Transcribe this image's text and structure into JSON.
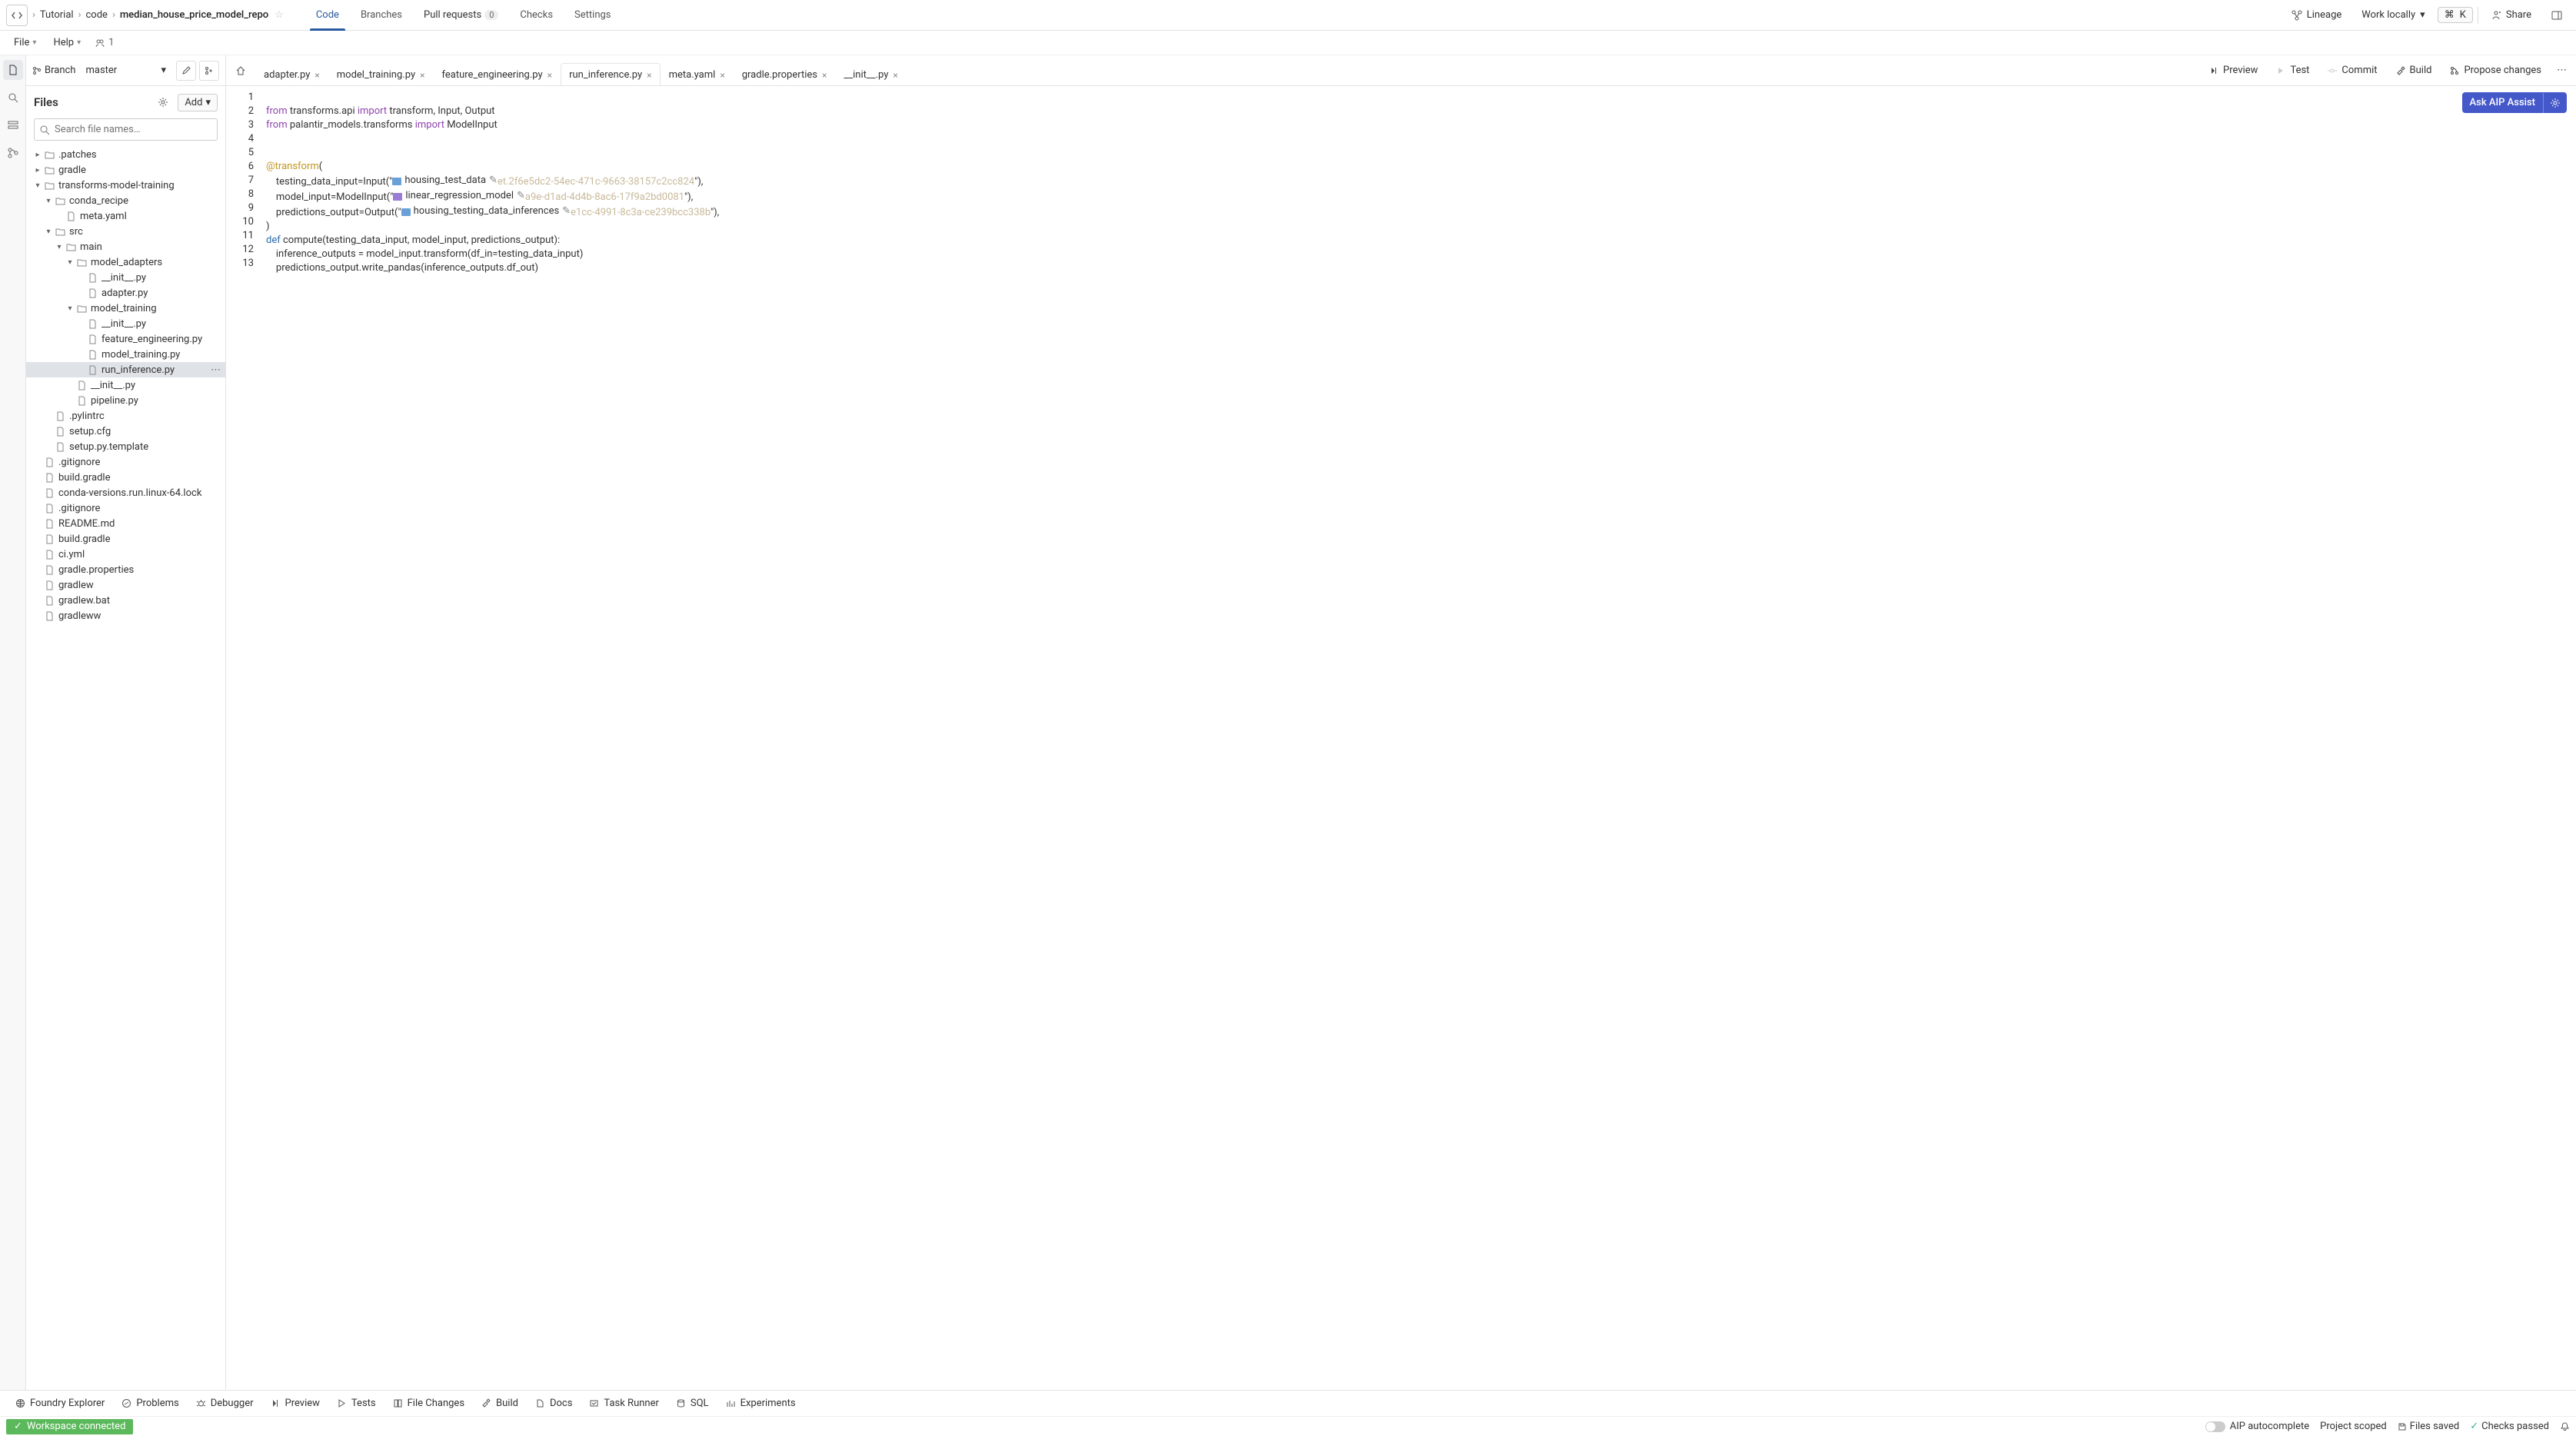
{
  "breadcrumb": [
    "Tutorial",
    "code",
    "median_house_price_model_repo"
  ],
  "menu": {
    "file": "File",
    "help": "Help",
    "avatar_count": "1"
  },
  "header_tabs": {
    "code": "Code",
    "branches": "Branches",
    "pulls": "Pull requests",
    "pulls_count": "0",
    "checks": "Checks",
    "settings": "Settings"
  },
  "hdr_right": {
    "lineage": "Lineage",
    "work": "Work locally",
    "cmd": "⌘",
    "k": "K",
    "share": "Share"
  },
  "branch": {
    "label": "Branch",
    "name": "master"
  },
  "files": {
    "title": "Files",
    "add": "Add",
    "search_ph": "Search file names…"
  },
  "tree": [
    {
      "indent": 0,
      "arrow": "▸",
      "icon": "folder",
      "name": ".patches"
    },
    {
      "indent": 0,
      "arrow": "▸",
      "icon": "folder",
      "name": "gradle"
    },
    {
      "indent": 0,
      "arrow": "▾",
      "icon": "folder",
      "name": "transforms-model-training"
    },
    {
      "indent": 1,
      "arrow": "▾",
      "icon": "folder",
      "name": "conda_recipe"
    },
    {
      "indent": 2,
      "arrow": "",
      "icon": "file",
      "name": "meta.yaml"
    },
    {
      "indent": 1,
      "arrow": "▾",
      "icon": "folder",
      "name": "src"
    },
    {
      "indent": 2,
      "arrow": "▾",
      "icon": "folder",
      "name": "main"
    },
    {
      "indent": 3,
      "arrow": "▾",
      "icon": "folder",
      "name": "model_adapters"
    },
    {
      "indent": 4,
      "arrow": "",
      "icon": "file",
      "name": "__init__.py"
    },
    {
      "indent": 4,
      "arrow": "",
      "icon": "file",
      "name": "adapter.py"
    },
    {
      "indent": 3,
      "arrow": "▾",
      "icon": "folder",
      "name": "model_training"
    },
    {
      "indent": 4,
      "arrow": "",
      "icon": "file",
      "name": "__init__.py"
    },
    {
      "indent": 4,
      "arrow": "",
      "icon": "file",
      "name": "feature_engineering.py"
    },
    {
      "indent": 4,
      "arrow": "",
      "icon": "file",
      "name": "model_training.py"
    },
    {
      "indent": 4,
      "arrow": "",
      "icon": "file",
      "name": "run_inference.py",
      "selected": true
    },
    {
      "indent": 3,
      "arrow": "",
      "icon": "file",
      "name": "__init__.py"
    },
    {
      "indent": 3,
      "arrow": "",
      "icon": "file",
      "name": "pipeline.py"
    },
    {
      "indent": 1,
      "arrow": "",
      "icon": "file",
      "name": ".pylintrc"
    },
    {
      "indent": 1,
      "arrow": "",
      "icon": "file",
      "name": "setup.cfg"
    },
    {
      "indent": 1,
      "arrow": "",
      "icon": "file",
      "name": "setup.py.template"
    },
    {
      "indent": 0,
      "arrow": "",
      "icon": "file",
      "name": ".gitignore"
    },
    {
      "indent": 0,
      "arrow": "",
      "icon": "file",
      "name": "build.gradle"
    },
    {
      "indent": 0,
      "arrow": "",
      "icon": "file",
      "name": "conda-versions.run.linux-64.lock"
    },
    {
      "indent": 0,
      "arrow": "",
      "icon": "file",
      "name": ".gitignore"
    },
    {
      "indent": 0,
      "arrow": "",
      "icon": "file",
      "name": "README.md"
    },
    {
      "indent": 0,
      "arrow": "",
      "icon": "file",
      "name": "build.gradle"
    },
    {
      "indent": 0,
      "arrow": "",
      "icon": "file",
      "name": "ci.yml"
    },
    {
      "indent": 0,
      "arrow": "",
      "icon": "file",
      "name": "gradle.properties"
    },
    {
      "indent": 0,
      "arrow": "",
      "icon": "file",
      "name": "gradlew"
    },
    {
      "indent": 0,
      "arrow": "",
      "icon": "file",
      "name": "gradlew.bat"
    },
    {
      "indent": 0,
      "arrow": "",
      "icon": "file",
      "name": "gradleww"
    }
  ],
  "editor_tabs": [
    {
      "name": "adapter.py"
    },
    {
      "name": "model_training.py"
    },
    {
      "name": "feature_engineering.py"
    },
    {
      "name": "run_inference.py",
      "active": true
    },
    {
      "name": "meta.yaml"
    },
    {
      "name": "gradle.properties"
    },
    {
      "name": "__init__.py"
    }
  ],
  "toolbar": {
    "preview": "Preview",
    "test": "Test",
    "commit": "Commit",
    "build": "Build",
    "propose": "Propose changes"
  },
  "aip": {
    "ask": "Ask AIP Assist"
  },
  "line_numbers": [
    "1",
    "2",
    "3",
    "4",
    "5",
    "6",
    "7",
    "8",
    "9",
    "10",
    "11",
    "12",
    "13"
  ],
  "code": {
    "l1_from": "from",
    "l1_mod": " transforms.api ",
    "l1_imp": "import",
    "l1_rest": " transform, Input, Output",
    "l2_from": "from",
    "l2_mod": " palantir_models.transforms ",
    "l2_imp": "import",
    "l2_rest": " ModelInput",
    "l5_dec": "@transform",
    "l5_paren": "(",
    "l6_pre": "    testing_data_input=Input(\"",
    "l6_chip": "housing_test_data",
    "l6_hash": "et.2f6e5dc2-54ec-471c-9663-38157c2cc824",
    "l6_post": "\"),",
    "l7_pre": "    model_input=ModelInput(\"",
    "l7_chip": "linear_regression_model",
    "l7_hash": "a9e-d1ad-4d4b-8ac6-17f9a2bd0081",
    "l7_post": "\"),",
    "l8_pre": "    predictions_output=Output(\"",
    "l8_chip": "housing_testing_data_inferences",
    "l8_hash": "e1cc-4991-8c3a-ce239bcc338b",
    "l8_post": "\"),",
    "l9": ")",
    "l10_def": "def",
    "l10_rest": " compute(testing_data_input, model_input, predictions_output):",
    "l11": "    inference_outputs = model_input.transform(df_in=testing_data_input)",
    "l12": "    predictions_output.write_pandas(inference_outputs.df_out)"
  },
  "bottom": {
    "explorer": "Foundry Explorer",
    "problems": "Problems",
    "debugger": "Debugger",
    "preview": "Preview",
    "tests": "Tests",
    "filechanges": "File Changes",
    "build": "Build",
    "docs": "Docs",
    "taskrunner": "Task Runner",
    "sql": "SQL",
    "experiments": "Experiments"
  },
  "status": {
    "workspace": "Workspace connected",
    "aip": "AIP autocomplete",
    "scope": "Project scoped",
    "saved": "Files saved",
    "checks": "Checks passed"
  }
}
